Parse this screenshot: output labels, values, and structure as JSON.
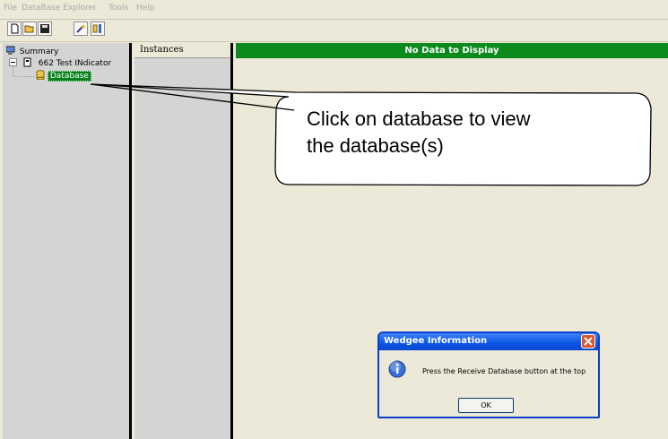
{
  "menu": [
    "File",
    "DataBase Explorer",
    "Tools",
    "Help"
  ],
  "toolbar": {
    "buttons": [
      "new-document-icon",
      "open-folder-icon",
      "save-disk-icon",
      "wand-icon",
      "database-settings-icon"
    ]
  },
  "tree": {
    "root_label": "Summary",
    "device_label": "662 Test INdicator",
    "database_label": "Database"
  },
  "instances": {
    "header": "Instances"
  },
  "main": {
    "header": "No Data to Display"
  },
  "dialog": {
    "title": "Wedgee Information",
    "message": "Press the Receive Database button at the top",
    "ok_label": "OK"
  },
  "callout": {
    "line1": "Click on database to view",
    "line2": "the database(s)"
  },
  "colors": {
    "accent_green": "#0b8a1d",
    "title_blue": "#0b55e3",
    "window_bg": "#ece9d8"
  }
}
